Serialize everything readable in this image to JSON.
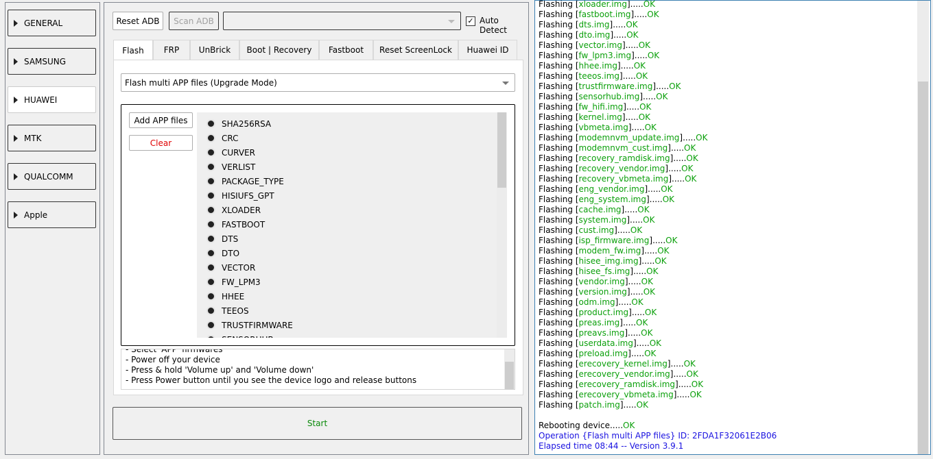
{
  "sidebar": {
    "items": [
      {
        "label": "GENERAL"
      },
      {
        "label": "SAMSUNG"
      },
      {
        "label": "HUAWEI",
        "selected": true
      },
      {
        "label": "MTK"
      },
      {
        "label": "QUALCOMM"
      },
      {
        "label": "Apple"
      }
    ]
  },
  "toolbar": {
    "reset_adb": "Reset ADB",
    "scan_adb": "Scan ADB",
    "port_value": "",
    "auto_detect": "Auto Detect",
    "auto_detect_checked": true
  },
  "tabs": [
    {
      "label": "Flash"
    },
    {
      "label": "FRP"
    },
    {
      "label": "UnBrick"
    },
    {
      "label": "Boot | Recovery"
    },
    {
      "label": "Fastboot"
    },
    {
      "label": "Reset ScreenLock"
    },
    {
      "label": "Huawei ID"
    }
  ],
  "flash": {
    "mode": "Flash multi APP files (Upgrade Mode)",
    "add_files": "Add APP files",
    "clear": "Clear",
    "partitions": [
      "SHA256RSA",
      "CRC",
      "CURVER",
      "VERLIST",
      "PACKAGE_TYPE",
      "HISIUFS_GPT",
      "XLOADER",
      "FASTBOOT",
      "DTS",
      "DTO",
      "VECTOR",
      "FW_LPM3",
      "HHEE",
      "TEEOS",
      "TRUSTFIRMWARE",
      "SENSORHUB"
    ],
    "notes": [
      "- Select 'APP' firmwares",
      "- Power off your device",
      "- Press & hold 'Volume up' and 'Volume down'",
      "- Press Power button until you see the device logo and release buttons"
    ],
    "start": "Start"
  },
  "log": {
    "prefix": "Flashing ",
    "ok": "OK",
    "dots": ".....",
    "files": [
      "xloader.img",
      "fastboot.img",
      "dts.img",
      "dto.img",
      "vector.img",
      "fw_lpm3.img",
      "hhee.img",
      "teeos.img",
      "trustfirmware.img",
      "sensorhub.img",
      "fw_hifi.img",
      "kernel.img",
      "vbmeta.img",
      "modemnvm_update.img",
      "modemnvm_cust.img",
      "recovery_ramdisk.img",
      "recovery_vendor.img",
      "recovery_vbmeta.img",
      "eng_vendor.img",
      "eng_system.img",
      "cache.img",
      "system.img",
      "cust.img",
      "isp_firmware.img",
      "modem_fw.img",
      "hisee_img.img",
      "hisee_fs.img",
      "vendor.img",
      "version.img",
      "odm.img",
      "product.img",
      "preas.img",
      "preavs.img",
      "userdata.img",
      "preload.img",
      "erecovery_kernel.img",
      "erecovery_vendor.img",
      "erecovery_ramdisk.img",
      "erecovery_vbmeta.img",
      "patch.img"
    ],
    "reboot": "Rebooting device.....",
    "operation": "Operation {Flash multi APP files} ID: 2FDA1F32061E2B06",
    "elapsed": "Elapsed time 08:44 -- Version 3.9.1"
  },
  "colors": {
    "ok": "#0ca00c",
    "info": "#1a12e0",
    "clear": "#e00000",
    "start": "#0a8a0a"
  }
}
